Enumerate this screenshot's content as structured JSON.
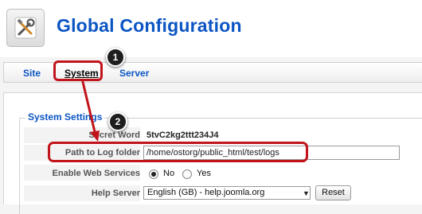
{
  "header": {
    "title": "Global Configuration",
    "icon": "tools-icon"
  },
  "tabs": [
    {
      "label": "Site",
      "active": false
    },
    {
      "label": "System",
      "active": true
    },
    {
      "label": "Server",
      "active": false
    }
  ],
  "annotations": {
    "callout_1": "1",
    "callout_2": "2",
    "highlight_color": "#c1141b"
  },
  "section": {
    "legend": "System Settings",
    "secret_word_label": "Secret Word",
    "secret_word_value": "5tvC2kg2ttt234J4",
    "log_path_label": "Path to Log folder",
    "log_path_value": "/home/ostorg/public_html/test/logs",
    "web_services_label": "Enable Web Services",
    "web_services_no": "No",
    "web_services_yes": "Yes",
    "web_services_selected": "No",
    "help_server_label": "Help Server",
    "help_server_value": "English (GB) - help.joomla.org",
    "reset_label": "Reset"
  },
  "colors": {
    "link_blue": "#0b55c4"
  }
}
